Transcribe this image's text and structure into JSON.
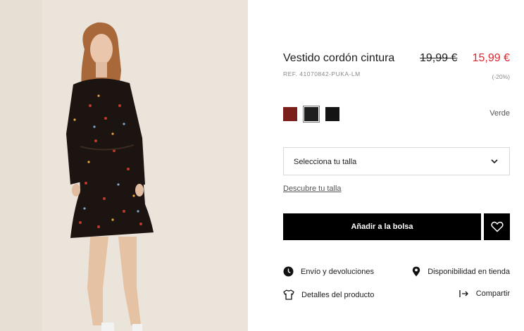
{
  "product": {
    "title": "Vestido cordón cintura",
    "old_price": "19,99 €",
    "new_price": "15,99 €",
    "reference": "REF. 41070842-PUKA-LM",
    "discount": "(-20%)",
    "image_alt": "Modelo con vestido estampado"
  },
  "colors": {
    "selected_name": "Verde",
    "swatches": [
      {
        "name": "granate",
        "hex": "#7a1f1a"
      },
      {
        "name": "negro-seleccionado",
        "hex": "#1f1f1f"
      },
      {
        "name": "negro",
        "hex": "#141414"
      }
    ]
  },
  "size": {
    "select_label": "Selecciona tu talla",
    "guide_link": "Descubre tu talla"
  },
  "actions": {
    "add_to_bag": "Añadir a la bolsa"
  },
  "info_links": {
    "shipping": "Envío y devoluciones",
    "availability": "Disponibilidad en tienda",
    "details": "Detalles del producto",
    "share": "Compartir"
  },
  "theme": {
    "accent_price": "#e0252d",
    "button_bg": "#000000"
  }
}
